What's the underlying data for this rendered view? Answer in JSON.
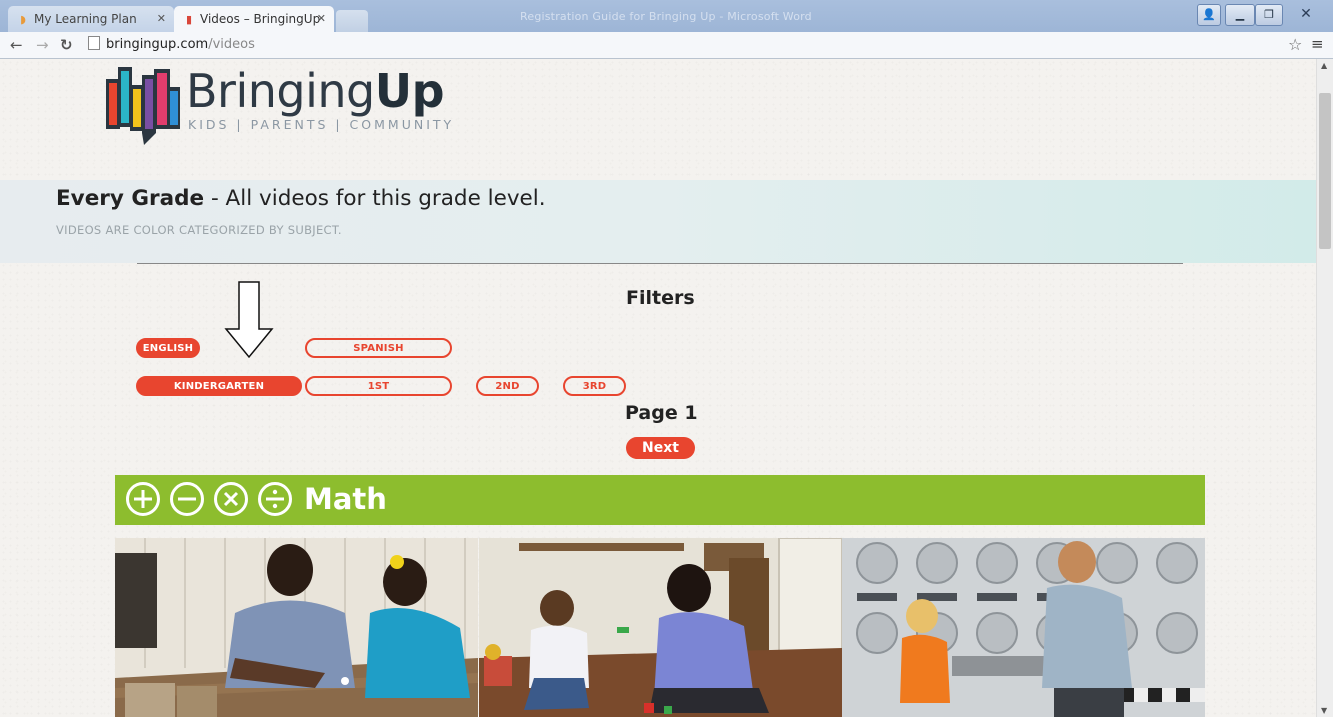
{
  "browser": {
    "tabs": [
      {
        "label": "My Learning Plan",
        "icon": "moodle-icon",
        "active": false
      },
      {
        "label": "Videos – BringingUp",
        "icon": "bringingup-favicon",
        "active": true
      }
    ],
    "background_window_title": "Registration Guide for Bringing Up - Microsoft Word",
    "url_host": "bringingup.com",
    "url_path": "/videos"
  },
  "logo": {
    "brand_regular": "Bringing",
    "brand_bold": "Up",
    "tagline": "KIDS | PARENTS | COMMUNITY"
  },
  "hero": {
    "title_bold": "Every Grade",
    "title_rest": " - All videos for this grade level.",
    "subtitle": "VIDEOS ARE COLOR CATEGORIZED BY SUBJECT."
  },
  "filters": {
    "title": "Filters",
    "languages": [
      {
        "label": "ENGLISH",
        "selected": true
      },
      {
        "label": "SPANISH",
        "selected": false
      }
    ],
    "grades": [
      {
        "label": "KINDERGARTEN",
        "selected": true
      },
      {
        "label": "1ST",
        "selected": false
      },
      {
        "label": "2ND",
        "selected": false
      },
      {
        "label": "3RD",
        "selected": false
      }
    ]
  },
  "pagination": {
    "page_label": "Page 1",
    "next_label": "Next"
  },
  "subject": {
    "label": "Math",
    "color": "#8dbd2e",
    "icons": [
      "plus-circle-icon",
      "minus-circle-icon",
      "times-circle-icon",
      "divide-circle-icon"
    ]
  },
  "colors": {
    "accent": "#e8452f",
    "math_green": "#8dbd2e"
  }
}
